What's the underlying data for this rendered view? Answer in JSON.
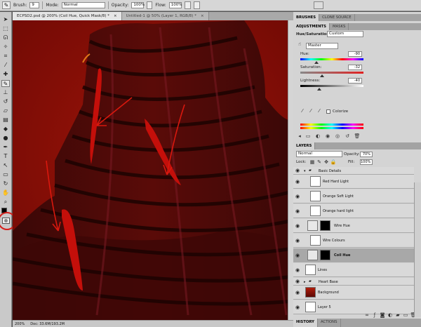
{
  "options_bar": {
    "brush_label": "Brush:",
    "brush_size": "9",
    "mode_label": "Mode:",
    "mode_value": "Normal",
    "opacity_label": "Opacity:",
    "opacity_value": "100%",
    "flow_label": "Flow:",
    "flow_value": "100%"
  },
  "doc_tabs": [
    {
      "label": "ECPSD2.psd @ 200% (Coil Hue, Quick Mask/8) *",
      "close": "×"
    },
    {
      "label": "Untitled-1 @ 50% (Layer 1, RGB/8) *",
      "close": "×"
    }
  ],
  "status": {
    "zoom": "200%",
    "doc_size": "Doc: 33.6M/193.2M"
  },
  "top_panel": {
    "tabs": [
      "BRUSHES",
      "CLONE SOURCE"
    ]
  },
  "adjustments": {
    "tabs": [
      "ADJUSTMENTS",
      "MASKS"
    ],
    "title": "Hue/Saturation",
    "preset": "Custom",
    "channel": "Master",
    "hue_label": "Hue:",
    "hue_value": "-90",
    "hue_level": 0.25,
    "saturation_label": "Saturation:",
    "saturation_value": "-32",
    "saturation_level": 0.34,
    "lightness_label": "Lightness:",
    "lightness_value": "-40",
    "lightness_level": 0.3,
    "colorize_label": "Colorize"
  },
  "layers": {
    "tab": "LAYERS",
    "blend_mode": "Normal",
    "opacity_label": "Opacity:",
    "opacity_value": "70%",
    "lock_label": "Lock:",
    "fill_label": "Fill:",
    "fill_value": "100%",
    "group_name": "Basic Details",
    "rows": [
      {
        "name": "Red Hard Light",
        "thumb": "blank"
      },
      {
        "name": "Orange Soft Light",
        "thumb": "blank"
      },
      {
        "name": "Orange hard light",
        "thumb": "blank"
      },
      {
        "name": "Wire Hue",
        "thumb": "adjust"
      },
      {
        "name": "Wire Colours",
        "thumb": "blank"
      },
      {
        "name": "Coil Hue",
        "thumb": "adjust"
      },
      {
        "name": "Lines",
        "thumb": "blank"
      }
    ],
    "heart_base": "Heart Base",
    "background": "Background",
    "layer5": "Layer 5"
  },
  "history": {
    "tabs": [
      "HISTORY",
      "ACTIONS"
    ]
  },
  "colors": {
    "canvas_red": "#8e0c07",
    "coil_dark": "#2a0706",
    "stroke_red": "#c2100b"
  }
}
